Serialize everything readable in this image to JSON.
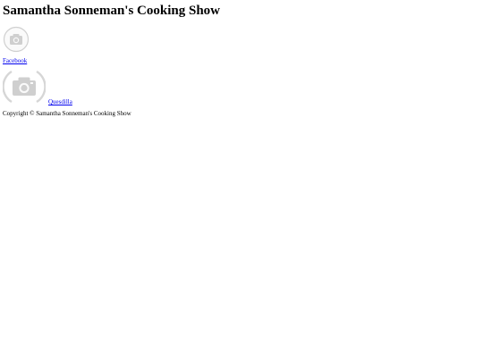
{
  "site": {
    "title": "Samantha Sonneman's Cooking Show"
  },
  "social": {
    "facebook_label": "Facebook",
    "icon": "camera-placeholder-icon"
  },
  "recipe": {
    "link_label": "Quesdilla",
    "icon": "camera-placeholder-icon"
  },
  "footer": {
    "copyright": "Copyright © Samantha Sonneman's Cooking Show"
  },
  "colors": {
    "link": "#0000ee",
    "placeholder_gray": "#d9d9d9"
  }
}
